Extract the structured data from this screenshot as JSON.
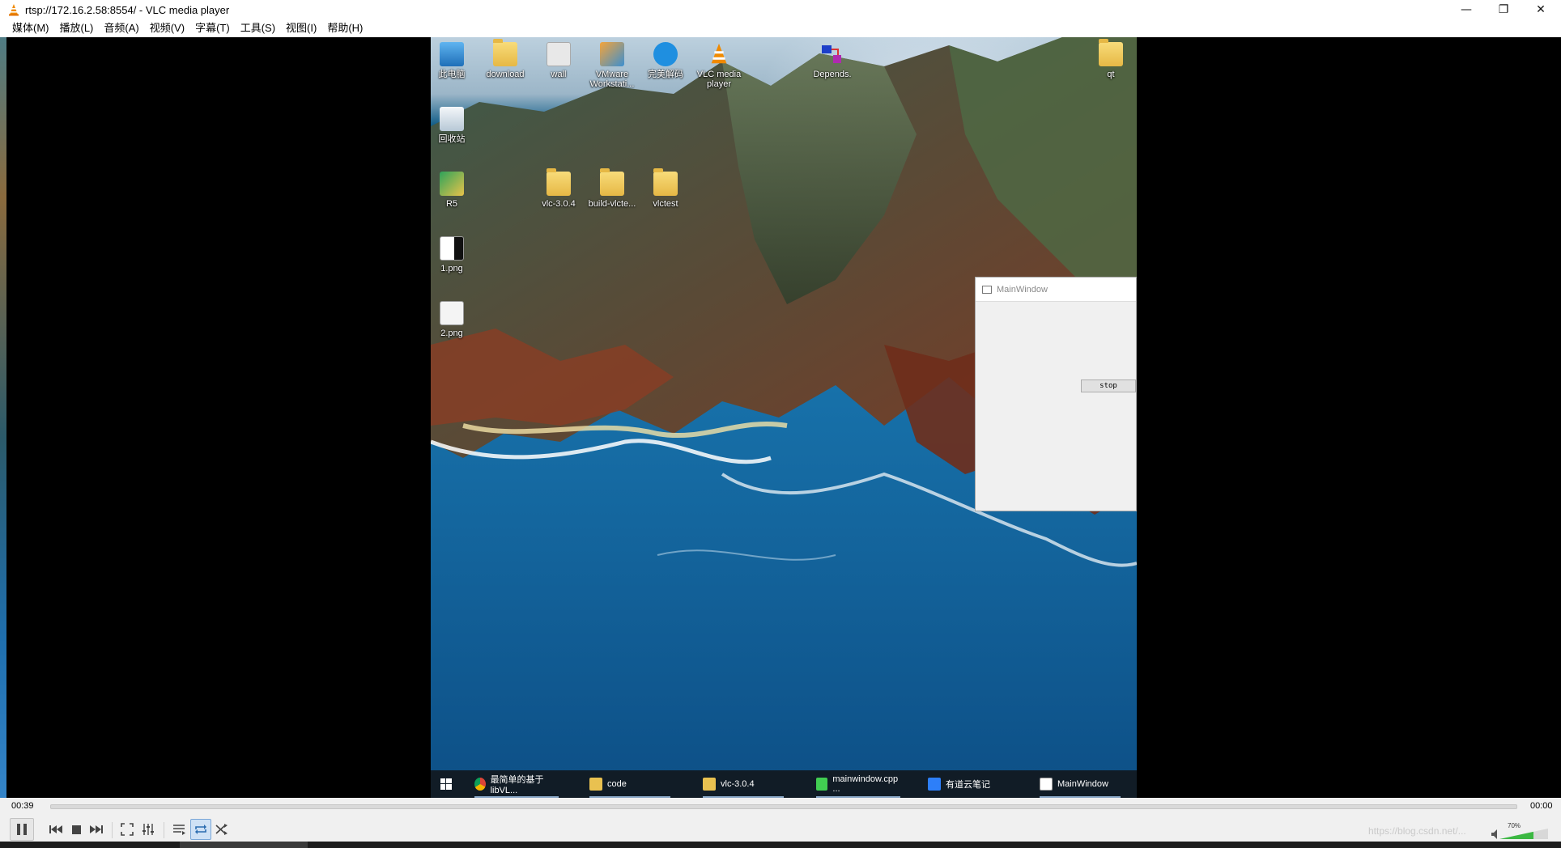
{
  "window": {
    "title": "rtsp://172.16.2.58:8554/ - VLC media player"
  },
  "menu": [
    "媒体(M)",
    "播放(L)",
    "音频(A)",
    "视频(V)",
    "字幕(T)",
    "工具(S)",
    "视图(I)",
    "帮助(H)"
  ],
  "desktop_icons": [
    {
      "label": "此电脑",
      "icon": "computer-icon"
    },
    {
      "label": "download",
      "icon": "folder-icon"
    },
    {
      "label": "wall",
      "icon": "image-icon"
    },
    {
      "label": "VMware Workstati...",
      "icon": "vmware-icon"
    },
    {
      "label": "完美解码",
      "icon": "media-player-icon"
    },
    {
      "label": "VLC media player",
      "icon": "vlc-icon"
    },
    {
      "label": "Depends.",
      "icon": "depends-icon"
    },
    {
      "label": "qt",
      "icon": "folder-icon"
    },
    {
      "label": "回收站",
      "icon": "recycle-bin-icon"
    },
    {
      "label": "R5",
      "icon": "r5-icon"
    },
    {
      "label": "vlc-3.0.4",
      "icon": "folder-icon"
    },
    {
      "label": "build-vlcte...",
      "icon": "folder-icon"
    },
    {
      "label": "vlctest",
      "icon": "folder-icon"
    },
    {
      "label": "1.png",
      "icon": "image-icon"
    },
    {
      "label": "2.png",
      "icon": "image-icon"
    }
  ],
  "inner_window": {
    "title": "MainWindow",
    "button": "stop"
  },
  "inner_taskbar": [
    {
      "label": "最简单的基于libVL...",
      "icon": "chrome-icon"
    },
    {
      "label": "code",
      "icon": "folder-icon"
    },
    {
      "label": "vlc-3.0.4",
      "icon": "folder-icon"
    },
    {
      "label": "mainwindow.cpp ...",
      "icon": "qtcreator-icon"
    },
    {
      "label": "有道云笔记",
      "icon": "notes-icon"
    },
    {
      "label": "MainWindow",
      "icon": "window-icon"
    }
  ],
  "player": {
    "current_time": "00:39",
    "total_time": "00:00",
    "progress": 0.0,
    "volume_label": "70%",
    "volume": 0.7
  },
  "watermark": "https://blog.csdn.net/..."
}
